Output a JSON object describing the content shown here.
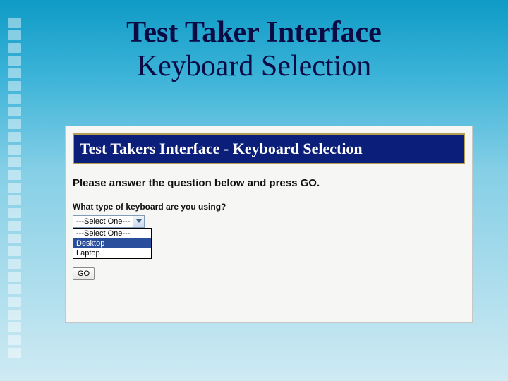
{
  "slide": {
    "title_line1": "Test Taker Interface",
    "title_line2": "Keyboard Selection"
  },
  "panel": {
    "banner_left": "Test Takers Interface",
    "banner_sep": " - ",
    "banner_right": "Keyboard Selection",
    "instruction": "Please answer the question below and press GO.",
    "question": "What type of keyboard are you using?",
    "select": {
      "selected_label": "---Select One---",
      "options": [
        "---Select One---",
        "Desktop",
        "Laptop"
      ],
      "highlighted_index": 1
    },
    "go_label": "GO"
  },
  "colors": {
    "banner_bg": "#0b1f7a",
    "banner_border": "#b59d52",
    "highlight_bg": "#284e9c"
  }
}
